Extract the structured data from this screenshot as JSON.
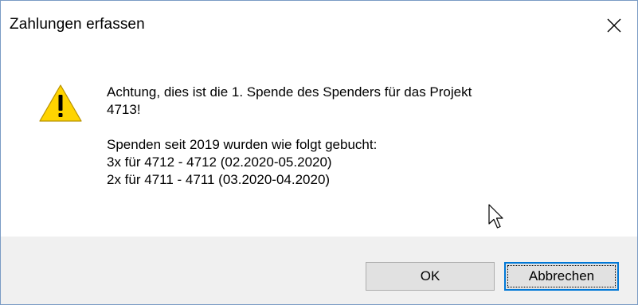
{
  "window": {
    "title": "Zahlungen erfassen",
    "close_symbol": "✕"
  },
  "icons": {
    "main": "warning-icon",
    "close": "close-icon",
    "pointer": "mouse-pointer-icon"
  },
  "colors": {
    "warning_fill": "#ffd400",
    "accent": "#0078d7",
    "footer_bg": "#f0f0f0"
  },
  "message": {
    "line1": "Achtung, dies ist die 1. Spende des Spenders für das Projekt",
    "line2": "4713!",
    "line3": "Spenden seit 2019 wurden wie folgt gebucht:",
    "line4": "3x für 4712 - 4712 (02.2020-05.2020)",
    "line5": "2x für 4711 - 4711 (03.2020-04.2020)"
  },
  "buttons": {
    "ok_label": "OK",
    "cancel_label": "Abbrechen"
  }
}
